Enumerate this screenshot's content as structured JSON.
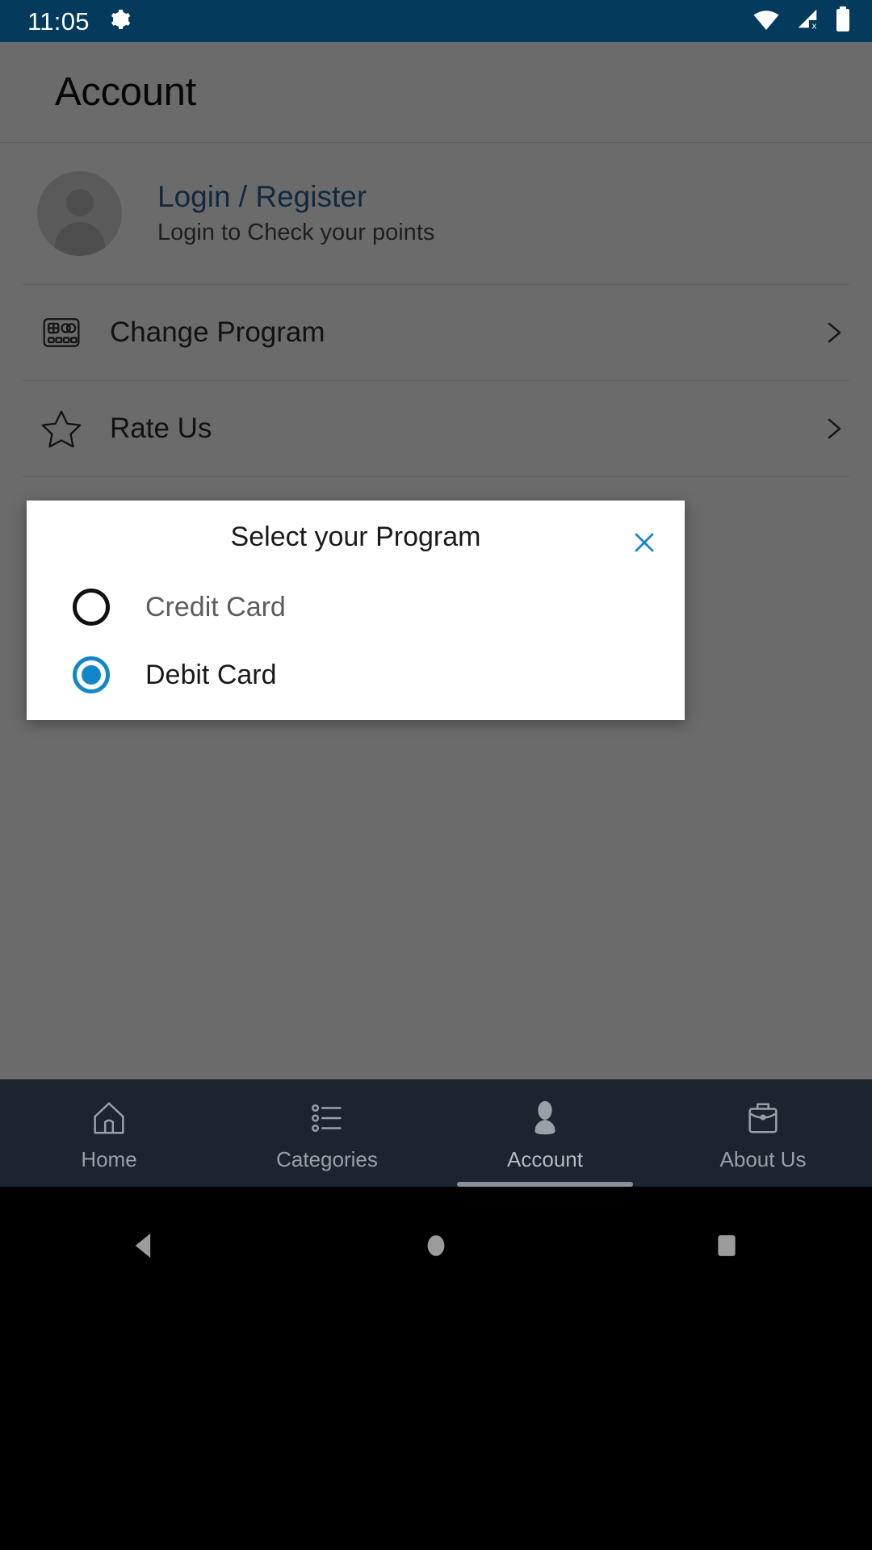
{
  "status_bar": {
    "time": "11:05",
    "icons": [
      "gear-icon",
      "wifi-icon",
      "cellular-no-sim-icon",
      "battery-icon"
    ],
    "background_color": "#043b5c"
  },
  "app": {
    "page_title": "Account",
    "profile": {
      "title": "Login / Register",
      "subtitle": "Login to Check your points",
      "title_color": "#2d6293",
      "avatar_icon": "person-placeholder-icon"
    },
    "menu_items": [
      {
        "label": "Change Program",
        "icon": "card-chip-icon",
        "chevron": "chevron-right-icon"
      },
      {
        "label": "Rate Us",
        "icon": "star-icon",
        "chevron": "chevron-right-icon"
      }
    ]
  },
  "dialog": {
    "title": "Select your Program",
    "close_icon": "close-x-icon",
    "close_color": "#1287c8",
    "accent_color": "#1287c8",
    "options": [
      {
        "label": "Credit Card",
        "selected": false
      },
      {
        "label": "Debit Card",
        "selected": true
      }
    ]
  },
  "tabbar": {
    "background_color": "#1c2430",
    "tabs": [
      {
        "label": "Home",
        "icon": "home-icon",
        "active": false
      },
      {
        "label": "Categories",
        "icon": "list-icon",
        "active": false
      },
      {
        "label": "Account",
        "icon": "person-icon",
        "active": true
      },
      {
        "label": "About Us",
        "icon": "briefcase-icon",
        "active": false
      }
    ]
  },
  "navbar": {
    "buttons": [
      {
        "name": "back-button",
        "icon": "triangle-left-icon"
      },
      {
        "name": "home-button",
        "icon": "circle-icon"
      },
      {
        "name": "recents-button",
        "icon": "square-icon"
      }
    ]
  }
}
